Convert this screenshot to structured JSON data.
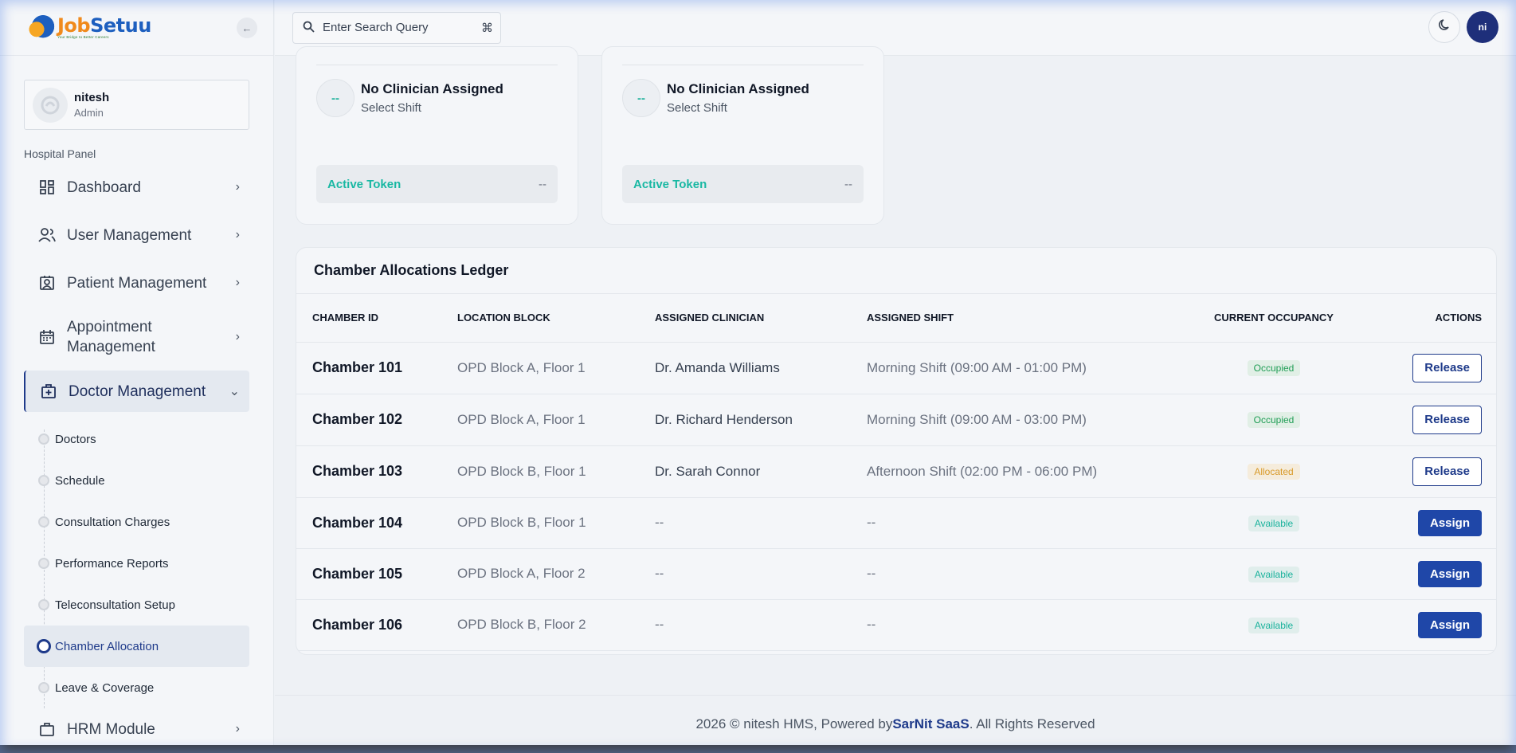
{
  "brand": {
    "name_part1": "Job",
    "name_part2": "Setuu",
    "tagline": "Your Bridge to Better Careers"
  },
  "sidebar": {
    "collapse_icon": "arrow-left-icon",
    "user": {
      "name": "nitesh",
      "role": "Admin"
    },
    "panel_label": "Hospital Panel",
    "items": [
      {
        "label": "Dashboard",
        "icon": "dashboard-icon"
      },
      {
        "label": "User Management",
        "icon": "users-icon"
      },
      {
        "label": "Patient Management",
        "icon": "patient-icon"
      },
      {
        "label": "Appointment Management",
        "icon": "calendar-icon"
      },
      {
        "label": "Doctor Management",
        "icon": "medical-bag-icon"
      },
      {
        "label": "HRM Module",
        "icon": "briefcase-icon"
      }
    ],
    "doctor_sub": [
      {
        "label": "Doctors"
      },
      {
        "label": "Schedule"
      },
      {
        "label": "Consultation Charges"
      },
      {
        "label": "Performance Reports"
      },
      {
        "label": "Teleconsultation Setup"
      },
      {
        "label": "Chamber Allocation"
      },
      {
        "label": "Leave & Coverage"
      }
    ]
  },
  "header": {
    "search_placeholder": "Enter Search Query",
    "search_shortcut": "⌘",
    "avatar_initials": "ni"
  },
  "cards": [
    {
      "clinician": "No Clinician Assigned",
      "shift": "Select Shift",
      "avatar": "--",
      "token_label": "Active Token",
      "token_value": "--"
    },
    {
      "clinician": "No Clinician Assigned",
      "shift": "Select Shift",
      "avatar": "--",
      "token_label": "Active Token",
      "token_value": "--"
    }
  ],
  "ledger": {
    "title": "Chamber Allocations Ledger",
    "columns": [
      "CHAMBER ID",
      "LOCATION BLOCK",
      "ASSIGNED CLINICIAN",
      "ASSIGNED SHIFT",
      "CURRENT OCCUPANCY",
      "ACTIONS"
    ],
    "rows": [
      {
        "id": "Chamber 101",
        "location": "OPD Block A, Floor 1",
        "clinician": "Dr. Amanda Williams",
        "shift": "Morning Shift (09:00 AM - 01:00 PM)",
        "status": "Occupied",
        "action": "Release"
      },
      {
        "id": "Chamber 102",
        "location": "OPD Block A, Floor 1",
        "clinician": "Dr. Richard Henderson",
        "shift": "Morning Shift (09:00 AM - 03:00 PM)",
        "status": "Occupied",
        "action": "Release"
      },
      {
        "id": "Chamber 103",
        "location": "OPD Block B, Floor 1",
        "clinician": "Dr. Sarah Connor",
        "shift": "Afternoon Shift (02:00 PM - 06:00 PM)",
        "status": "Allocated",
        "action": "Release"
      },
      {
        "id": "Chamber 104",
        "location": "OPD Block B, Floor 1",
        "clinician": "--",
        "shift": "--",
        "status": "Available",
        "action": "Assign"
      },
      {
        "id": "Chamber 105",
        "location": "OPD Block A, Floor 2",
        "clinician": "--",
        "shift": "--",
        "status": "Available",
        "action": "Assign"
      },
      {
        "id": "Chamber 106",
        "location": "OPD Block B, Floor 2",
        "clinician": "--",
        "shift": "--",
        "status": "Available",
        "action": "Assign"
      }
    ]
  },
  "footer": {
    "prefix": "2026 © nitesh HMS, Powered by ",
    "brand": "SarNit SaaS",
    "suffix": ". All Rights Reserved"
  },
  "colors": {
    "accent": "#1e3a8a",
    "teal": "#19b8a3",
    "occupied": "#1f9d55",
    "allocated": "#d89a2a"
  }
}
